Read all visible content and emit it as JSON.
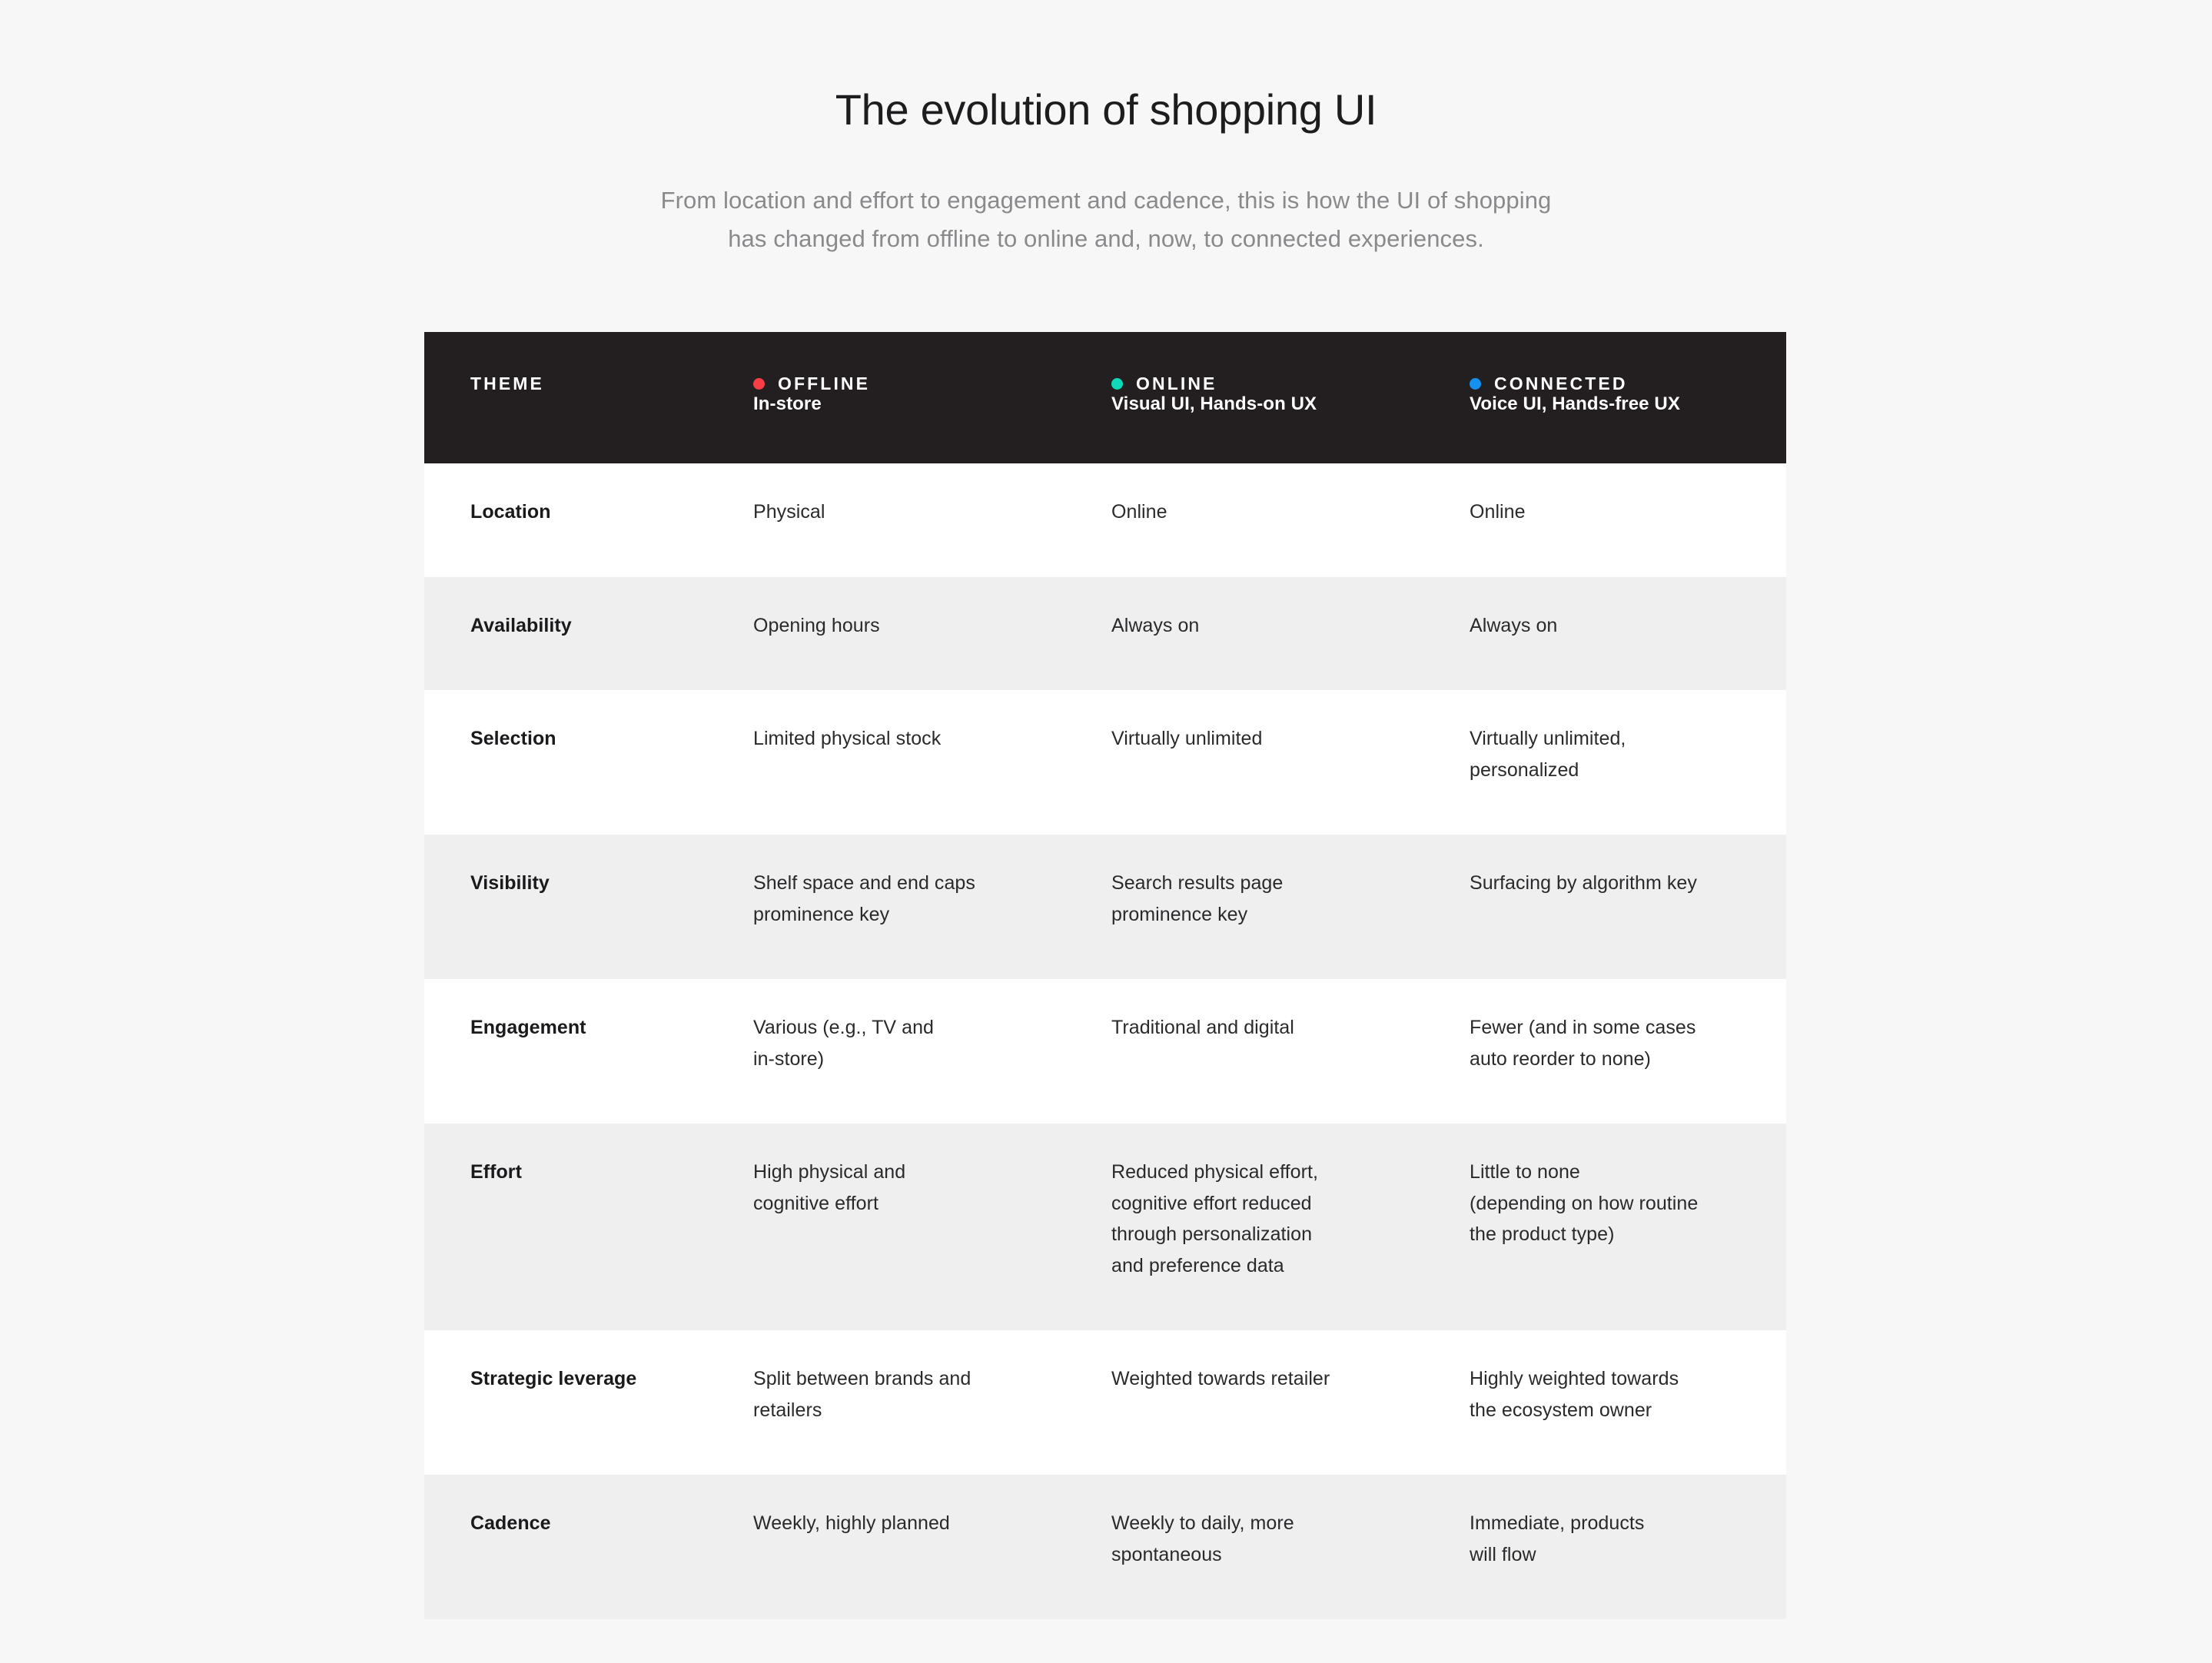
{
  "header": {
    "title": "The evolution of shopping UI",
    "subtitle_lines": [
      "From location and effort to engagement and cadence, this is how the UI of shopping",
      "has changed from offline to online and, now, to connected experiences."
    ]
  },
  "colors": {
    "page_background": "#f7f7f7",
    "table_header_background": "#231f20",
    "row_background": "#ffffff",
    "row_alt_background": "#efeff0",
    "title_text": "#1d1d1f",
    "subtitle_text": "#8a8a8d",
    "body_text": "#2a2a2c",
    "dot_offline": "#f73d46",
    "dot_online": "#0fd9b6",
    "dot_connected": "#1490f0"
  },
  "table": {
    "columns": [
      {
        "label": "THEME",
        "sublabel": "",
        "dot": null,
        "dot_icon": null
      },
      {
        "label": "OFFLINE",
        "sublabel": "In-store",
        "dot": "#f73d46",
        "dot_icon": "red-dot-icon"
      },
      {
        "label": "ONLINE",
        "sublabel": "Visual UI, Hands-on UX",
        "dot": "#0fd9b6",
        "dot_icon": "teal-dot-icon"
      },
      {
        "label": "CONNECTED",
        "sublabel": "Voice UI, Hands-free UX",
        "dot": "#1490f0",
        "dot_icon": "blue-dot-icon"
      }
    ],
    "rows": [
      {
        "theme": "Location",
        "offline": [
          "Physical"
        ],
        "online": [
          "Online"
        ],
        "connected": [
          "Online"
        ]
      },
      {
        "theme": "Availability",
        "offline": [
          "Opening hours"
        ],
        "online": [
          "Always on"
        ],
        "connected": [
          "Always on"
        ]
      },
      {
        "theme": "Selection",
        "offline": [
          "Limited physical stock"
        ],
        "online": [
          "Virtually unlimited"
        ],
        "connected": [
          "Virtually unlimited,",
          "personalized"
        ]
      },
      {
        "theme": "Visibility",
        "offline": [
          "Shelf space and end caps",
          "prominence key"
        ],
        "online": [
          "Search results page",
          "prominence key"
        ],
        "connected": [
          "Surfacing by algorithm key"
        ]
      },
      {
        "theme": "Engagement",
        "offline": [
          "Various (e.g., TV and",
          "in-store)"
        ],
        "online": [
          "Traditional and digital"
        ],
        "connected": [
          "Fewer (and in some cases",
          "auto reorder to none)"
        ]
      },
      {
        "theme": "Effort",
        "offline": [
          "High physical and",
          "cognitive effort"
        ],
        "online": [
          "Reduced physical effort,",
          "cognitive effort reduced",
          "through personalization",
          "and preference data"
        ],
        "connected": [
          "Little to none",
          "(depending on how routine",
          "the product type)"
        ]
      },
      {
        "theme": "Strategic leverage",
        "offline": [
          "Split between brands and",
          "retailers"
        ],
        "online": [
          "Weighted towards retailer"
        ],
        "connected": [
          "Highly weighted towards",
          "the ecosystem owner"
        ]
      },
      {
        "theme": "Cadence",
        "offline": [
          "Weekly, highly planned"
        ],
        "online": [
          "Weekly to daily, more",
          "spontaneous"
        ],
        "connected": [
          "Immediate, products",
          "will flow"
        ]
      }
    ]
  }
}
